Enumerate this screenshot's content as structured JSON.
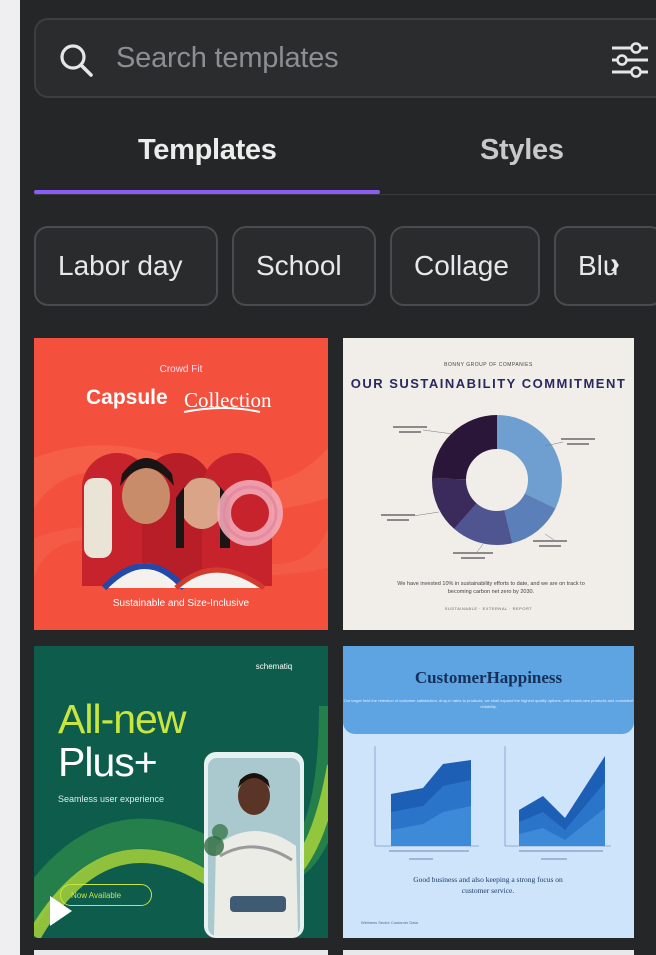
{
  "search": {
    "placeholder": "Search templates",
    "icon": "search-icon",
    "filter_icon": "filter-sliders-icon"
  },
  "tabs": [
    {
      "label": "Templates",
      "active": true
    },
    {
      "label": "Styles",
      "active": false
    }
  ],
  "accent_color": "#8b5cf6",
  "chips": [
    {
      "label": "Labor day"
    },
    {
      "label": "School"
    },
    {
      "label": "Collage"
    },
    {
      "label": "Blu"
    }
  ],
  "chip_scroll_icon": "chevron-right-icon",
  "templates": [
    {
      "brand": "Crowd Fit",
      "title_bold": "Capsule",
      "title_script": "Collection",
      "caption": "Sustainable and Size-Inclusive"
    },
    {
      "kicker": "BONNY GROUP OF COMPANIES",
      "title": "OUR SUSTAINABILITY COMMITMENT",
      "body": "We have invested 10% in sustainability efforts to date, and we are on track to becoming carbon net zero by 2030.",
      "footer": "SUSTAINABLE · EXTERNAL · REPORT"
    },
    {
      "logo": "schematiq",
      "headline_1": "All-new",
      "headline_2": "Plus+",
      "sub": "Seamless user experience",
      "button": "Now Available"
    },
    {
      "title": "CustomerHappiness",
      "body": "Our target held the retention of customer satisfaction, drop-in rates to products, we shall expand the highest quality options, with brand-new products and consistent reliability.",
      "caption": "Good business and also keeping a strong focus on customer service.",
      "credit": "Wellness Sector Customer Data"
    }
  ]
}
